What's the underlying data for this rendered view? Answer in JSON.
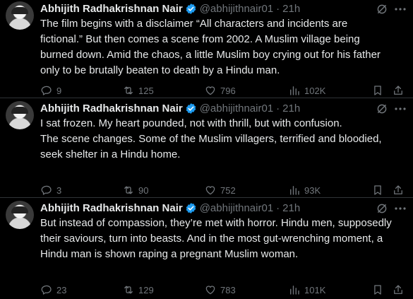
{
  "author": {
    "name": "Abhijith Radhakrishnan Nair",
    "handle": "@abhijithnair01",
    "dot": "·"
  },
  "tweets": [
    {
      "time": "21h",
      "lines": [
        "The film begins with a disclaimer “All characters and incidents are",
        "fictional.” But then comes a scene from 2002. A Muslim village being",
        "burned down. Amid the chaos, a little Muslim boy crying out for his father",
        "only to be brutally beaten to death by a Hindu man."
      ],
      "replies": "9",
      "reposts": "125",
      "likes": "796",
      "views": "102K"
    },
    {
      "time": "21h",
      "lines": [
        "I sat frozen. My heart pounded, not with thrill, but with confusion.",
        "The scene changes. Some of the Muslim villagers, terrified and bloodied,",
        "seek shelter in a Hindu home."
      ],
      "replies": "3",
      "reposts": "90",
      "likes": "752",
      "views": "93K"
    },
    {
      "time": "21h",
      "lines": [
        "But instead of compassion, they’re met with horror. Hindu men, supposedly",
        "their saviours, turn into beasts. And in the most gut-wrenching moment, a",
        "Hindu man is shown raping a pregnant Muslim woman."
      ],
      "replies": "23",
      "reposts": "129",
      "likes": "783",
      "views": "101K"
    }
  ],
  "colors": {
    "background": "#000000",
    "text": "#e7e9ea",
    "muted": "#71767b",
    "verified": "#1d9bf0",
    "divider": "#2f3336"
  },
  "icons": [
    "verified-badge-icon",
    "grok-icon",
    "more-icon",
    "reply-icon",
    "repost-icon",
    "like-icon",
    "views-icon",
    "bookmark-icon",
    "share-icon"
  ]
}
